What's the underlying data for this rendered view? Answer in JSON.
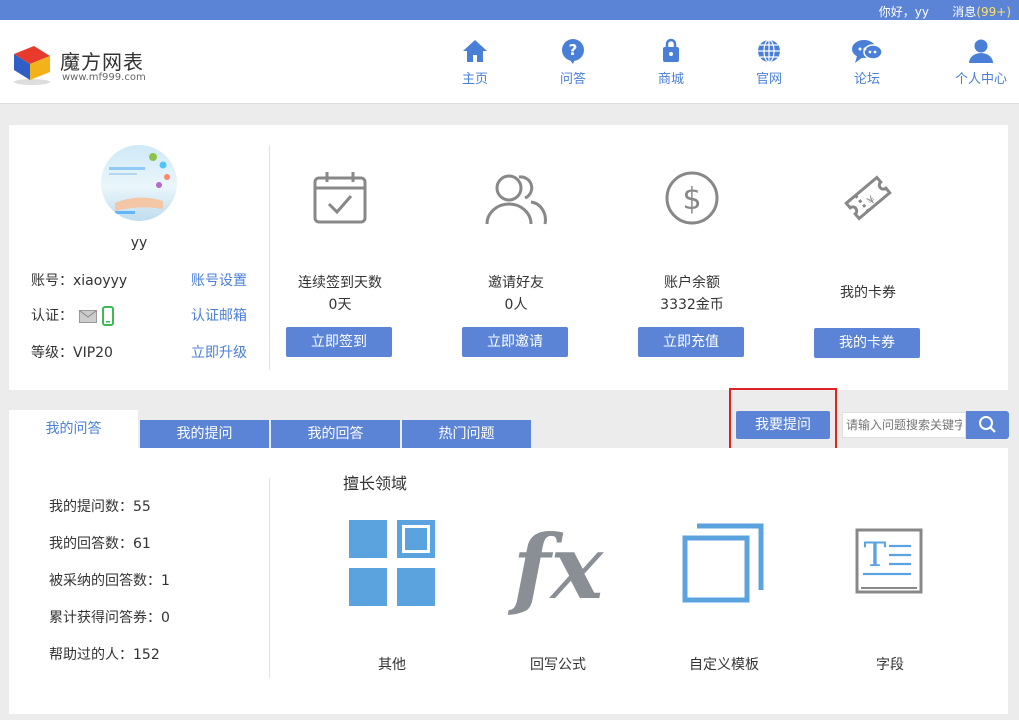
{
  "topbar": {
    "greeting": "你好，yy",
    "messages_label": "消息",
    "messages_count": "(99+)"
  },
  "logo": {
    "name": "魔方网表",
    "url": "www.mf999.com"
  },
  "nav": [
    {
      "label": "主页",
      "icon": "home-icon"
    },
    {
      "label": "问答",
      "icon": "question-icon"
    },
    {
      "label": "商城",
      "icon": "shopping-bag-icon"
    },
    {
      "label": "官网",
      "icon": "globe-icon"
    },
    {
      "label": "论坛",
      "icon": "chat-bubbles-icon"
    },
    {
      "label": "个人中心",
      "icon": "user-icon"
    }
  ],
  "profile": {
    "username": "yy",
    "account_label": "账号：xiaoyyy",
    "account_link": "账号设置",
    "verify_label": "认证：",
    "verify_link": "认证邮箱",
    "level_label": "等级：VIP20",
    "level_link": "立即升级"
  },
  "stats": [
    {
      "label": "连续签到天数",
      "value": "0天",
      "button": "立即签到",
      "icon": "calendar-check-icon"
    },
    {
      "label": "邀请好友",
      "value": "0人",
      "button": "立即邀请",
      "icon": "users-icon"
    },
    {
      "label": "账户余额",
      "value": "3332金币",
      "button": "立即充值",
      "icon": "dollar-icon"
    },
    {
      "label": "我的卡券",
      "value": "",
      "button": "我的卡券",
      "icon": "ticket-icon"
    }
  ],
  "tabs": [
    "我的问答",
    "我的提问",
    "我的回答",
    "热门问题"
  ],
  "ask_button": "我要提问",
  "search": {
    "placeholder": "请输入问题搜索关键字"
  },
  "qa_stats": [
    "我的提问数：55",
    "我的回答数：61",
    "被采纳的回答数：1",
    "累计获得问答券：0",
    "帮助过的人：152"
  ],
  "fields": {
    "title": "擅长领域",
    "items": [
      {
        "label": "其他",
        "icon": "grid-icon"
      },
      {
        "label": "回写公式",
        "icon": "fx-formula-icon"
      },
      {
        "label": "自定义模板",
        "icon": "stacked-squares-icon"
      },
      {
        "label": "字段",
        "icon": "text-field-icon"
      }
    ]
  },
  "colors": {
    "primary": "#5b84d6",
    "link": "#4a7fd8",
    "highlight": "#e02424"
  }
}
